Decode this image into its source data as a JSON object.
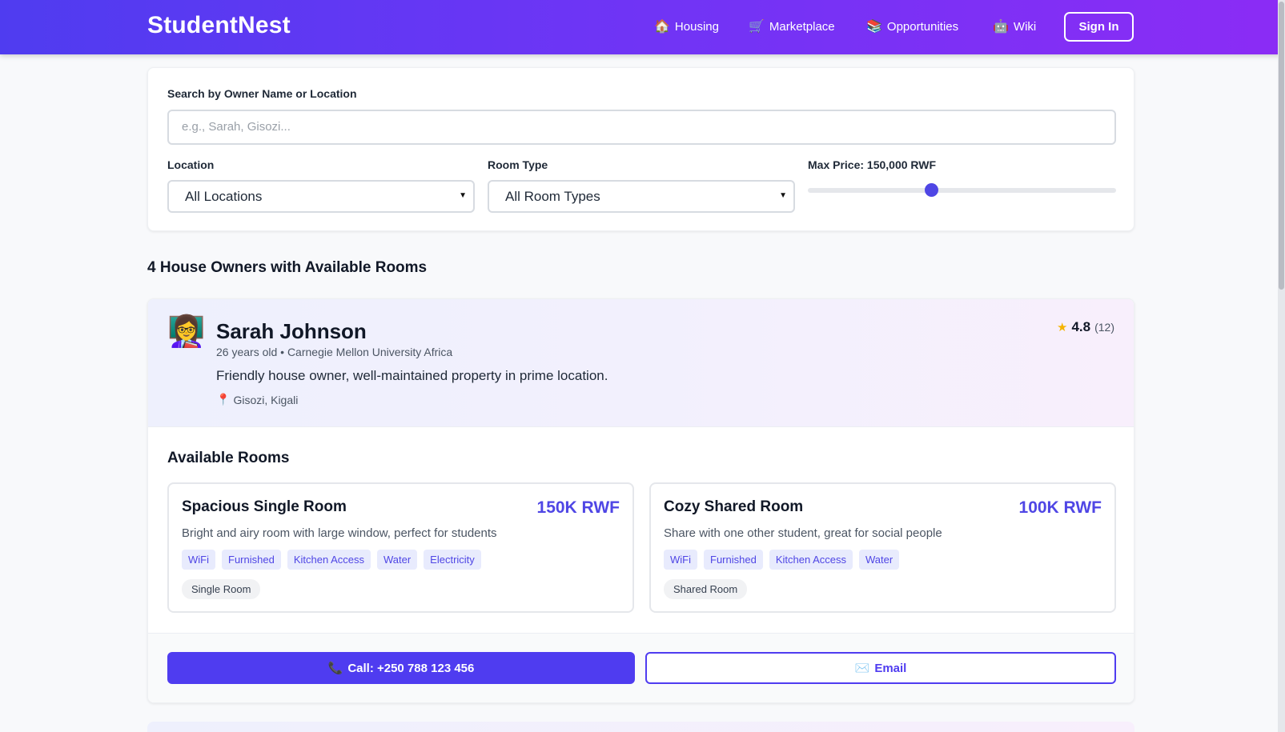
{
  "header": {
    "brand": "StudentNest",
    "nav": [
      {
        "icon": "house-icon",
        "glyph": "🏠",
        "label": "Housing"
      },
      {
        "icon": "cart-icon",
        "glyph": "🛒",
        "label": "Marketplace"
      },
      {
        "icon": "books-icon",
        "glyph": "📚",
        "label": "Opportunities"
      },
      {
        "icon": "robot-icon",
        "glyph": "🤖",
        "label": "Wiki"
      }
    ],
    "signin_label": "Sign In"
  },
  "filters": {
    "search_label": "Search by Owner Name or Location",
    "search_placeholder": "e.g., Sarah, Gisozi...",
    "location_label": "Location",
    "location_value": "All Locations",
    "room_type_label": "Room Type",
    "room_type_value": "All Room Types",
    "max_price_label": "Max Price: 150,000 RWF",
    "max_price_fraction": 0.4
  },
  "results": {
    "count_text": "4 House Owners with Available Rooms"
  },
  "owner": {
    "avatar_glyph": "👩‍🏫",
    "name": "Sarah Johnson",
    "meta": "26 years old • Carnegie Mellon University Africa",
    "bio": "Friendly house owner, well-maintained property in prime location.",
    "location_glyph": "📍",
    "location": "Gisozi, Kigali",
    "rating_star": "★",
    "rating": "4.8",
    "rating_count": "(12)",
    "rooms_heading": "Available Rooms",
    "rooms": [
      {
        "title": "Spacious Single Room",
        "price": "150K RWF",
        "desc": "Bright and airy room with large window, perfect for students",
        "tags": [
          "WiFi",
          "Furnished",
          "Kitchen Access",
          "Water",
          "Electricity"
        ],
        "type": "Single Room"
      },
      {
        "title": "Cozy Shared Room",
        "price": "100K RWF",
        "desc": "Share with one other student, great for social people",
        "tags": [
          "WiFi",
          "Furnished",
          "Kitchen Access",
          "Water"
        ],
        "type": "Shared Room"
      }
    ],
    "call_glyph": "📞",
    "call_label": "Call: +250 788 123 456",
    "email_glyph": "✉️",
    "email_label": "Email"
  },
  "colors": {
    "accent": "#4f46e5",
    "header_gradient_start": "#4f3cf0",
    "header_gradient_end": "#8b2cf5",
    "star": "#f5b400"
  }
}
